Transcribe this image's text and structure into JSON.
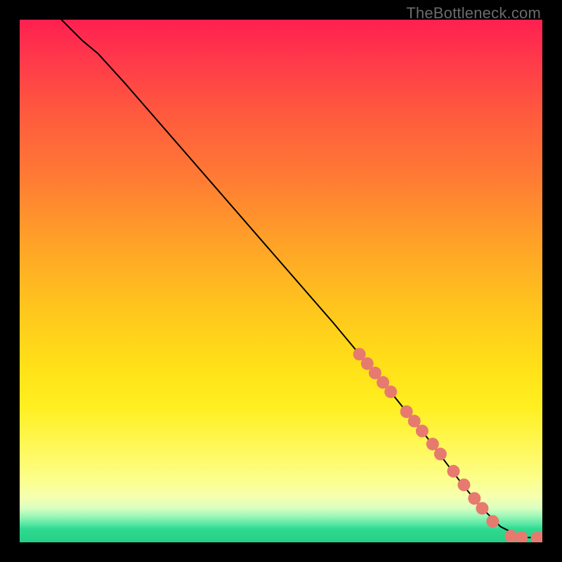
{
  "watermark": "TheBottleneck.com",
  "chart_data": {
    "type": "line",
    "title": "",
    "xlabel": "",
    "ylabel": "",
    "xlim": [
      0,
      100
    ],
    "ylim": [
      0,
      100
    ],
    "series": [
      {
        "name": "curve",
        "color": "#000000",
        "x": [
          8,
          10,
          12,
          15,
          20,
          30,
          40,
          50,
          60,
          70,
          78,
          84,
          88,
          92,
          96,
          100
        ],
        "y": [
          100,
          98,
          96,
          93.5,
          88,
          76.5,
          65,
          53.5,
          42,
          30,
          20,
          12,
          7,
          3,
          1,
          0.8
        ]
      },
      {
        "name": "markers",
        "color": "#e77a6e",
        "x": [
          65,
          66.5,
          68,
          69.5,
          71,
          74,
          75.5,
          77,
          79,
          80.5,
          83,
          85,
          87,
          88.5,
          90.5,
          94,
          96,
          99,
          100
        ],
        "y": [
          36,
          34.2,
          32.4,
          30.6,
          28.8,
          25,
          23.2,
          21.3,
          18.8,
          16.9,
          13.6,
          11,
          8.4,
          6.5,
          4,
          1.2,
          0.9,
          0.8,
          0.8
        ]
      }
    ]
  }
}
